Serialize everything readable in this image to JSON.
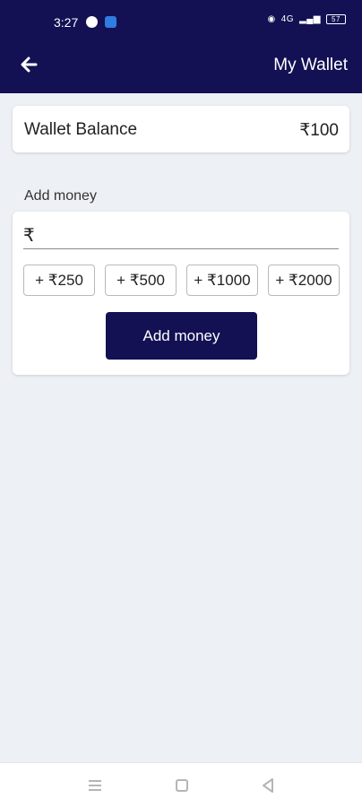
{
  "status_bar": {
    "time": "3:27",
    "network": "4G",
    "battery": "57"
  },
  "app_bar": {
    "title": "My Wallet",
    "back_icon": "arrow-left-icon"
  },
  "wallet": {
    "balance_label": "Wallet Balance",
    "balance_value": "₹100"
  },
  "add_money": {
    "section_label": "Add money",
    "currency_prefix": "₹",
    "amount_value": "",
    "amount_placeholder": "",
    "quick_amounts": [
      "+ ₹250",
      "+ ₹500",
      "+ ₹1000",
      "+ ₹2000"
    ],
    "submit_label": "Add money"
  },
  "colors": {
    "primary": "#131054",
    "background": "#edf0f4",
    "card": "#ffffff"
  },
  "nav_bar": {
    "icons": [
      "menu-icon",
      "home-square-icon",
      "back-triangle-icon"
    ]
  }
}
